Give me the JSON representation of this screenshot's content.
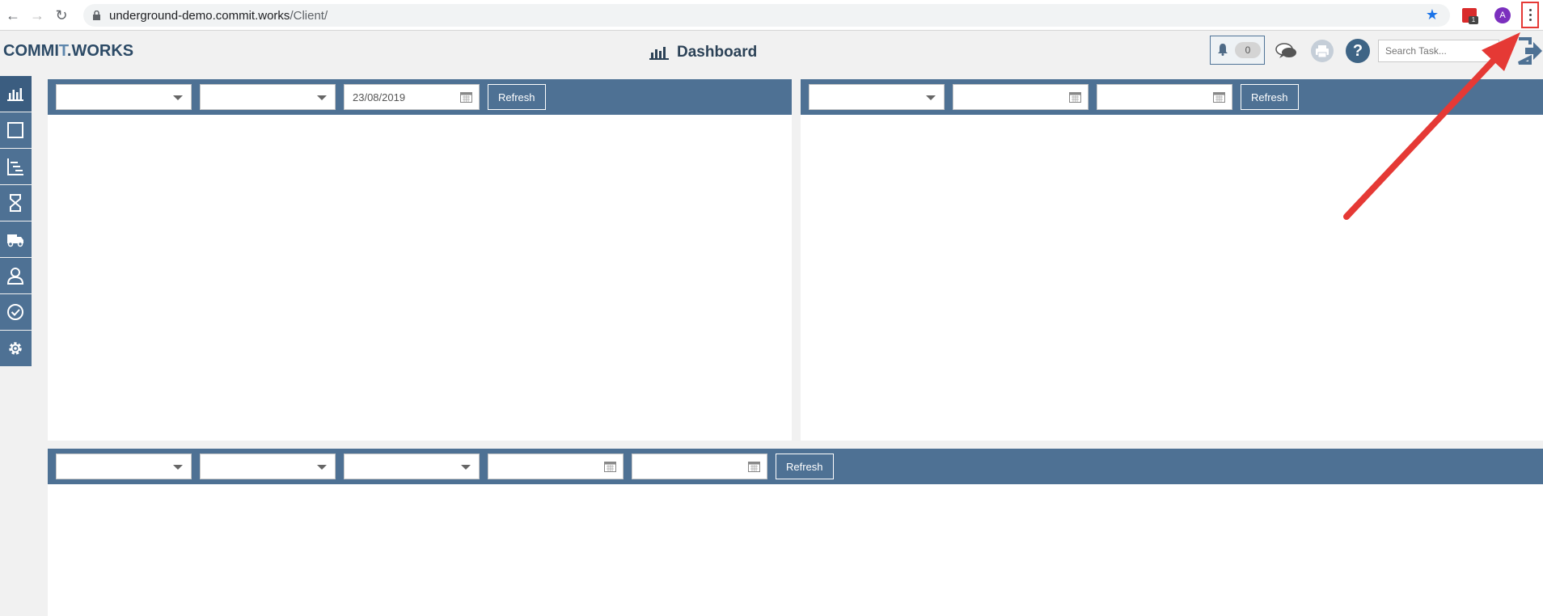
{
  "browser": {
    "url_domain": "underground-demo.commit.works",
    "url_path": "/Client/",
    "profile_initial": "A",
    "extension_badge": "1"
  },
  "app": {
    "logo_text_a": "COMMI",
    "logo_text_plus": "T",
    "logo_text_b": ".WORKS",
    "page_title": "Dashboard",
    "notification_count": "0",
    "search_placeholder": "Search Task..."
  },
  "sidebar": {
    "items": [
      {
        "icon": "bar-chart-icon"
      },
      {
        "icon": "square-icon"
      },
      {
        "icon": "hierarchy-icon"
      },
      {
        "icon": "hourglass-icon"
      },
      {
        "icon": "truck-icon"
      },
      {
        "icon": "user-icon"
      },
      {
        "icon": "check-circle-icon"
      },
      {
        "icon": "gear-icon"
      }
    ]
  },
  "panels": {
    "top_left": {
      "date_value": "23/08/2019",
      "refresh_label": "Refresh"
    },
    "top_right": {
      "refresh_label": "Refresh"
    },
    "bottom": {
      "refresh_label": "Refresh"
    }
  },
  "colors": {
    "accent": "#4e7194",
    "highlight": "#e53935"
  }
}
